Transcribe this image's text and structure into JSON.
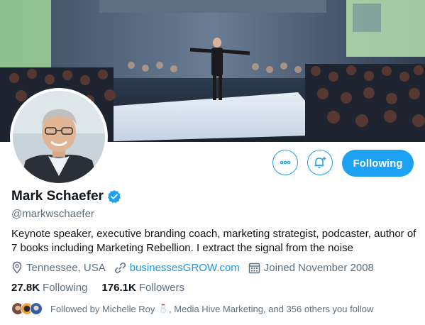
{
  "profile": {
    "name": "Mark Schaefer",
    "handle": "@markwschaefer",
    "bio": "Keynote speaker, executive branding coach, marketing strategist, podcaster, author of 7 books including Marketing Rebellion. I extract the signal from the noise",
    "location": "Tennessee, USA",
    "website": "businessesGROW.com",
    "joined": "Joined November 2008",
    "verified": true
  },
  "actions": {
    "more_icon": "more-icon",
    "notify_icon": "bell-plus-icon",
    "following_label": "Following"
  },
  "stats": {
    "following_count": "27.8K",
    "following_label": "Following",
    "followers_count": "176.1K",
    "followers_label": "Followers"
  },
  "followed_by": {
    "prefix": "Followed by",
    "first_name": "Michelle Roy",
    "rest": ", Media Hive Marketing, and 356 others you follow"
  },
  "colors": {
    "accent": "#1da1f2",
    "link": "#1b95e0",
    "secondary_text": "#5b7083",
    "primary_text": "#0f1419"
  }
}
